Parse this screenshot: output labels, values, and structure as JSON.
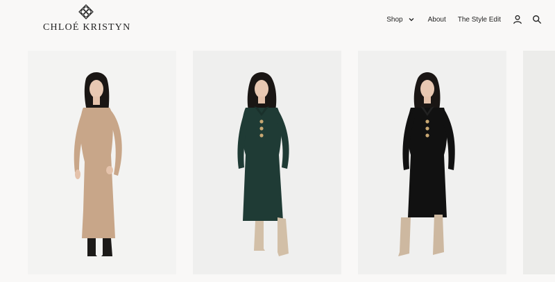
{
  "brand": {
    "name": "CHLOÉ KRISTYN",
    "logo_icon": "interlocking-knot-icon"
  },
  "nav": {
    "items": [
      {
        "label": "Shop",
        "has_dropdown": true
      },
      {
        "label": "About"
      },
      {
        "label": "The Style Edit"
      }
    ],
    "icons": [
      "account-icon",
      "search-icon"
    ]
  },
  "products": [
    {
      "dress_color": "#c8a689",
      "boot_color": "#1c1a19",
      "collar": false
    },
    {
      "dress_color": "#1f3b35",
      "boot_color": "#d2bfa7",
      "collar": true
    },
    {
      "dress_color": "#111111",
      "boot_color": "#cdb8a0",
      "collar": true
    },
    {
      "dress_color": "#e3e1de"
    }
  ]
}
